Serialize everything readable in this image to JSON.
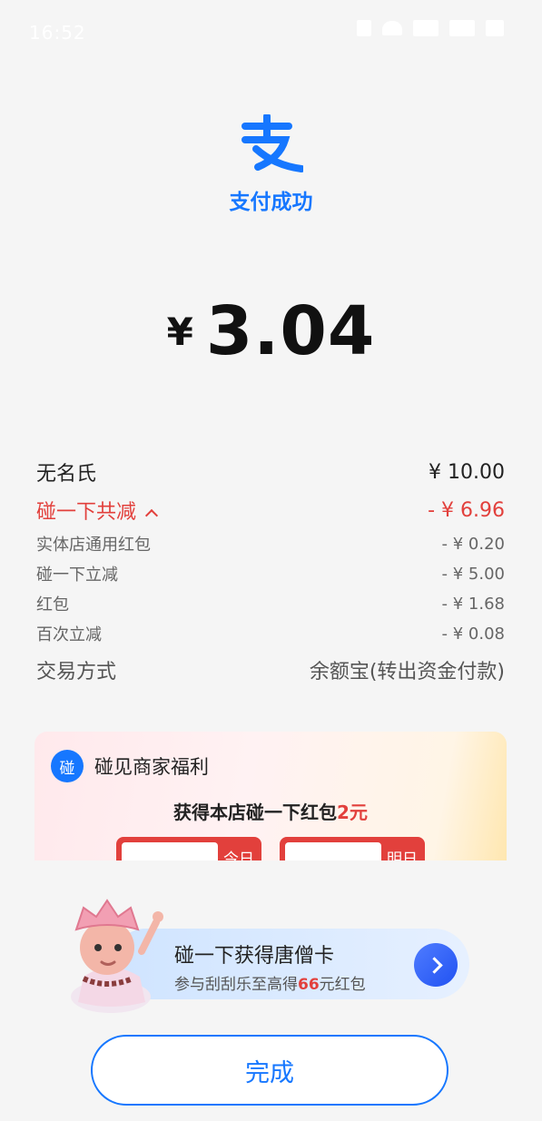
{
  "status_bar": {
    "time": "16:52"
  },
  "header": {
    "title": "支付成功"
  },
  "payment": {
    "currency": "¥",
    "amount": "3.04"
  },
  "details": {
    "payee": {
      "label": "无名氏",
      "value": "¥ 10.00"
    },
    "discount": {
      "label": "碰一下共减",
      "value": "- ¥ 6.96"
    },
    "discount_items": [
      {
        "label": "实体店通用红包",
        "value": "- ¥ 0.20"
      },
      {
        "label": "碰一下立减",
        "value": "- ¥ 5.00"
      },
      {
        "label": "红包",
        "value": "- ¥ 1.68"
      },
      {
        "label": "百次立减",
        "value": "- ¥ 0.08"
      }
    ],
    "method": {
      "label": "交易方式",
      "value": "余额宝(转出资金付款)"
    }
  },
  "card": {
    "badge": "碰",
    "title": "碰见商家福利",
    "subtitle_prefix": "获得本店碰一下红包",
    "subtitle_amount": "2元",
    "coupons": [
      {
        "tag": "今日"
      },
      {
        "tag": "明日"
      }
    ]
  },
  "banner": {
    "title": "碰一下获得唐僧卡",
    "line_prefix": "参与刮刮乐至高得",
    "line_amount": "66",
    "line_suffix": "元红包"
  },
  "actions": {
    "done_label": "完成"
  },
  "colors": {
    "brand": "#1677ff",
    "discount_red": "#e2403c",
    "background": "#f5f5f5"
  }
}
